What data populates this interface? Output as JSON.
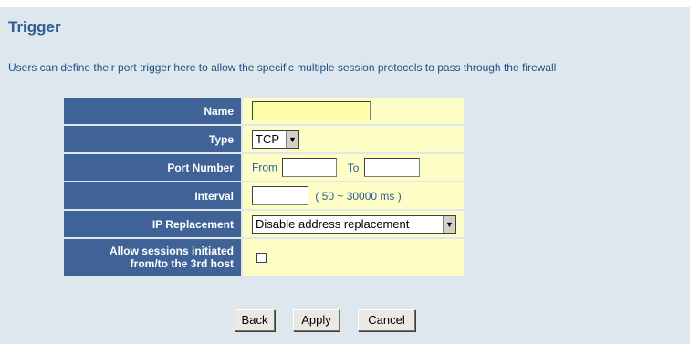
{
  "page": {
    "title": "Trigger",
    "description": "Users can define their port trigger here to allow the specific multiple session protocols to pass through the firewall"
  },
  "form": {
    "name_label": "Name",
    "name_value": "",
    "type_label": "Type",
    "type_value": "TCP",
    "port_label": "Port Number",
    "port_from_label": "From",
    "port_from_value": "",
    "port_to_label": "To",
    "port_to_value": "",
    "interval_label": "Interval",
    "interval_value": "",
    "interval_hint": "( 50 ~ 30000 ms )",
    "ip_label": "IP Replacement",
    "ip_value": "Disable address replacement",
    "allow_label_line1": "Allow sessions initiated",
    "allow_label_line2": "from/to the 3rd host",
    "allow_checked": false
  },
  "buttons": {
    "back": "Back",
    "apply": "Apply",
    "cancel": "Cancel"
  },
  "colors": {
    "label_bg": "#3f6396",
    "value_bg": "#fffdc6",
    "panel_bg": "#dfe7ee",
    "title": "#2f5e8f"
  }
}
